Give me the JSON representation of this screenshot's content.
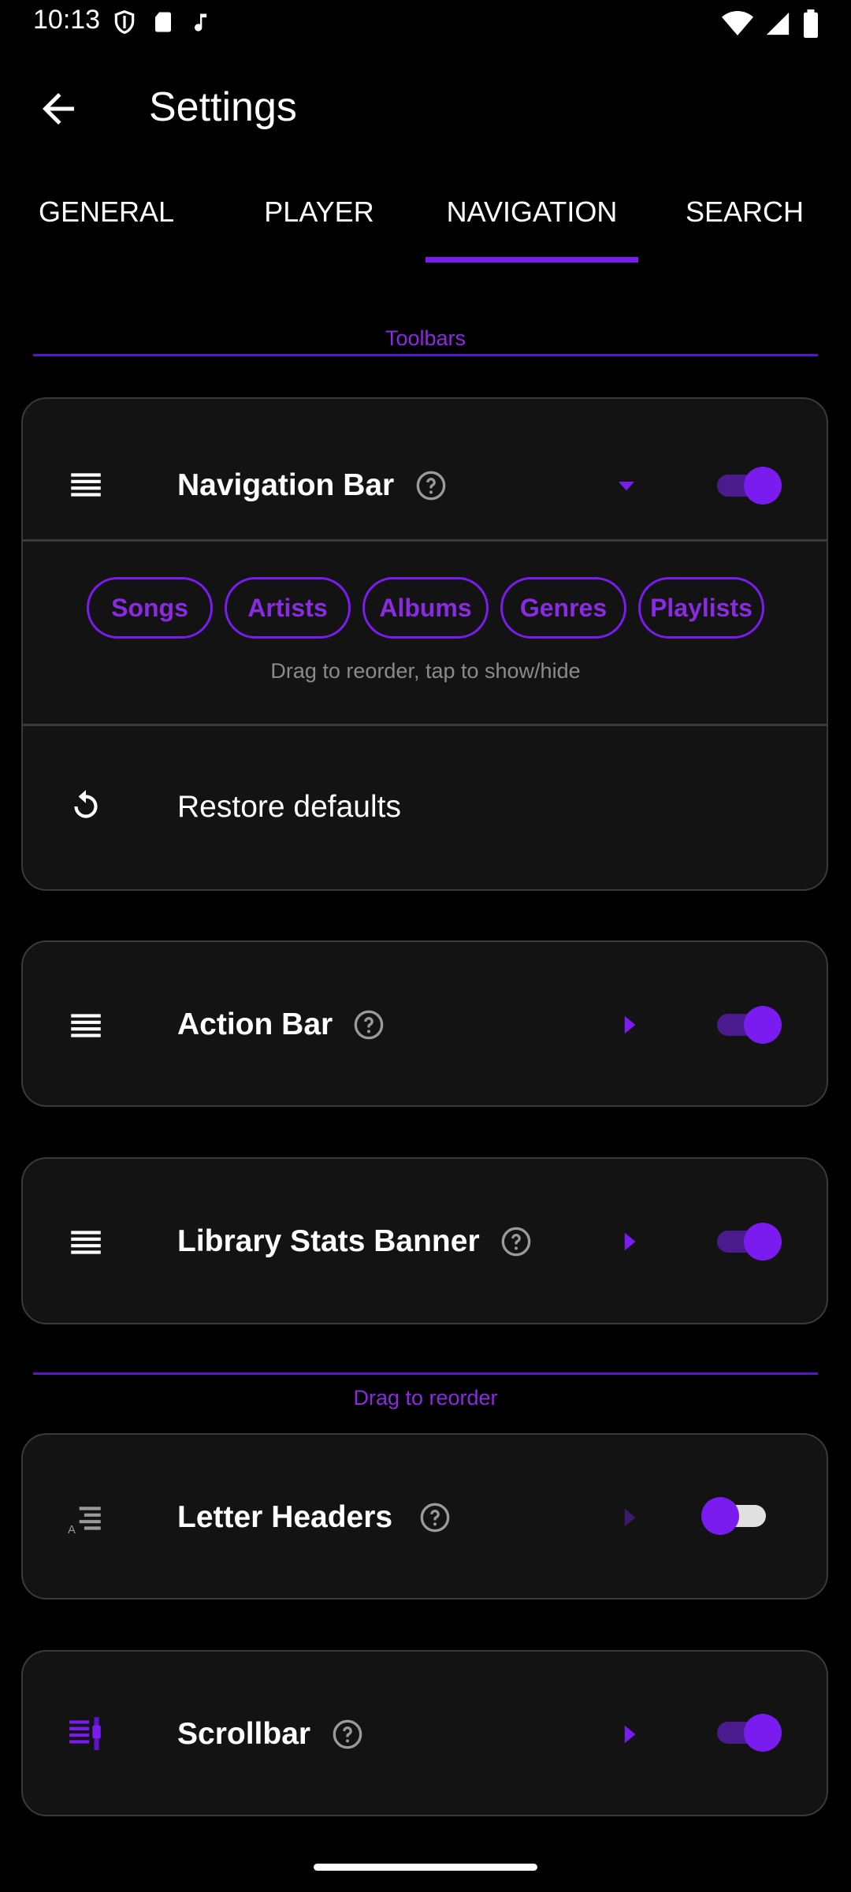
{
  "status_bar": {
    "time": "10:13",
    "left_icons": [
      "shield-icon",
      "sd-card-icon",
      "music-note-icon"
    ],
    "right_icons": [
      "wifi-icon",
      "signal-icon",
      "battery-icon"
    ]
  },
  "app_bar": {
    "title": "Settings"
  },
  "tabs": [
    {
      "label": "GENERAL",
      "active": false
    },
    {
      "label": "PLAYER",
      "active": false
    },
    {
      "label": "NAVIGATION",
      "active": true
    },
    {
      "label": "SEARCH",
      "active": false
    }
  ],
  "sections": {
    "toolbars_label": "Toolbars",
    "reorder_label": "Drag to reorder"
  },
  "navigation_bar": {
    "title": "Navigation Bar",
    "enabled": true,
    "chips": [
      "Songs",
      "Artists",
      "Albums",
      "Genres",
      "Playlists"
    ],
    "hint": "Drag to reorder, tap to show/hide",
    "restore_label": "Restore defaults"
  },
  "action_bar": {
    "title": "Action Bar",
    "enabled": true
  },
  "library_stats_banner": {
    "title": "Library Stats Banner",
    "enabled": true
  },
  "letter_headers": {
    "title": "Letter Headers",
    "enabled": false
  },
  "scrollbar": {
    "title": "Scrollbar",
    "enabled": true
  },
  "colors": {
    "accent": "#7a1cf0",
    "card_bg": "#131313",
    "border": "#3a3a3a"
  }
}
